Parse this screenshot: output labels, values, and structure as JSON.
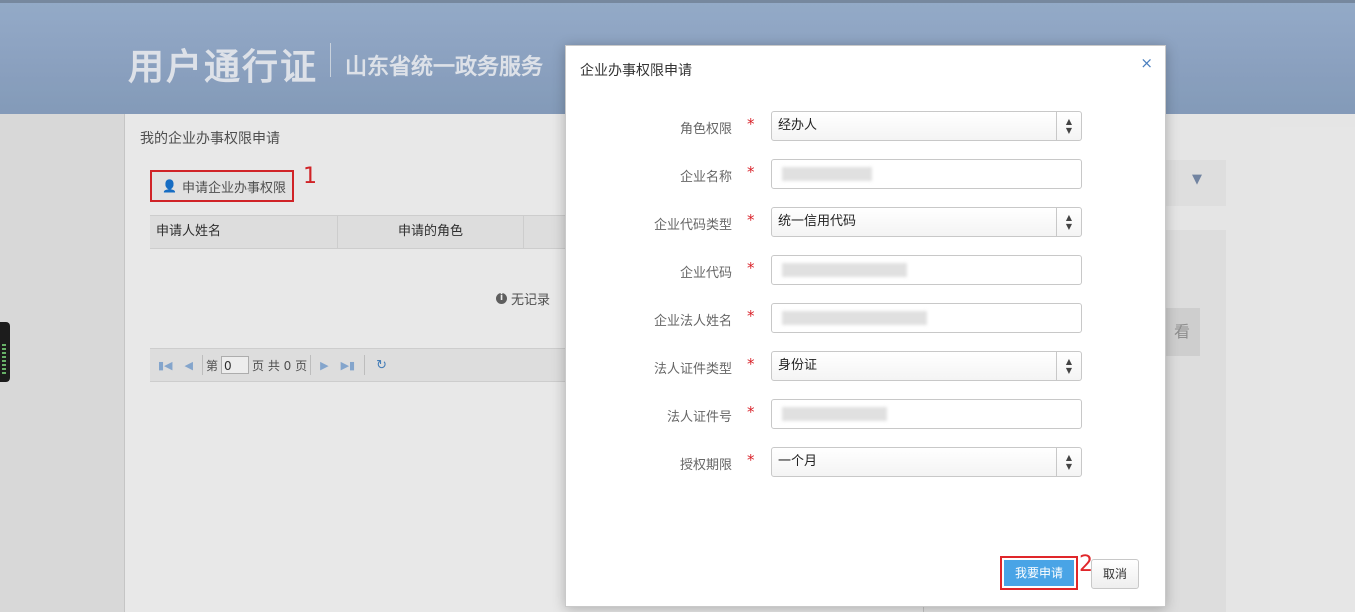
{
  "header": {
    "brand": "用户通行证",
    "subtitle": "山东省统一政务服务"
  },
  "panel": {
    "title": "我的企业办事权限申请",
    "apply_button": "申请企业办事权限",
    "annotation_1": "1",
    "table_headers": [
      "申请人姓名",
      "申请的角色"
    ],
    "empty_text": "无记录",
    "pager": {
      "page_prefix": "第",
      "page_value": "0",
      "page_suffix": "页 共 0 页"
    }
  },
  "right": {
    "button_text": "看"
  },
  "modal": {
    "title": "企业办事权限申请",
    "close": "×",
    "fields": [
      {
        "label": "角色权限",
        "required": "*",
        "type": "select",
        "value": "经办人"
      },
      {
        "label": "企业名称",
        "required": "*",
        "type": "input",
        "value": ""
      },
      {
        "label": "企业代码类型",
        "required": "*",
        "type": "select",
        "value": "统一信用代码"
      },
      {
        "label": "企业代码",
        "required": "*",
        "type": "input",
        "value": ""
      },
      {
        "label": "企业法人姓名",
        "required": "*",
        "type": "input",
        "value": ""
      },
      {
        "label": "法人证件类型",
        "required": "*",
        "type": "select",
        "value": "身份证"
      },
      {
        "label": "法人证件号",
        "required": "*",
        "type": "input",
        "value": ""
      },
      {
        "label": "授权期限",
        "required": "*",
        "type": "select",
        "value": "一个月"
      }
    ],
    "submit_button": "我要申请",
    "cancel_button": "取消",
    "annotation_2": "2"
  },
  "colors": {
    "accent": "#49a4e6",
    "annotation": "#e0262a",
    "header_bg": "#9fb7d7"
  }
}
